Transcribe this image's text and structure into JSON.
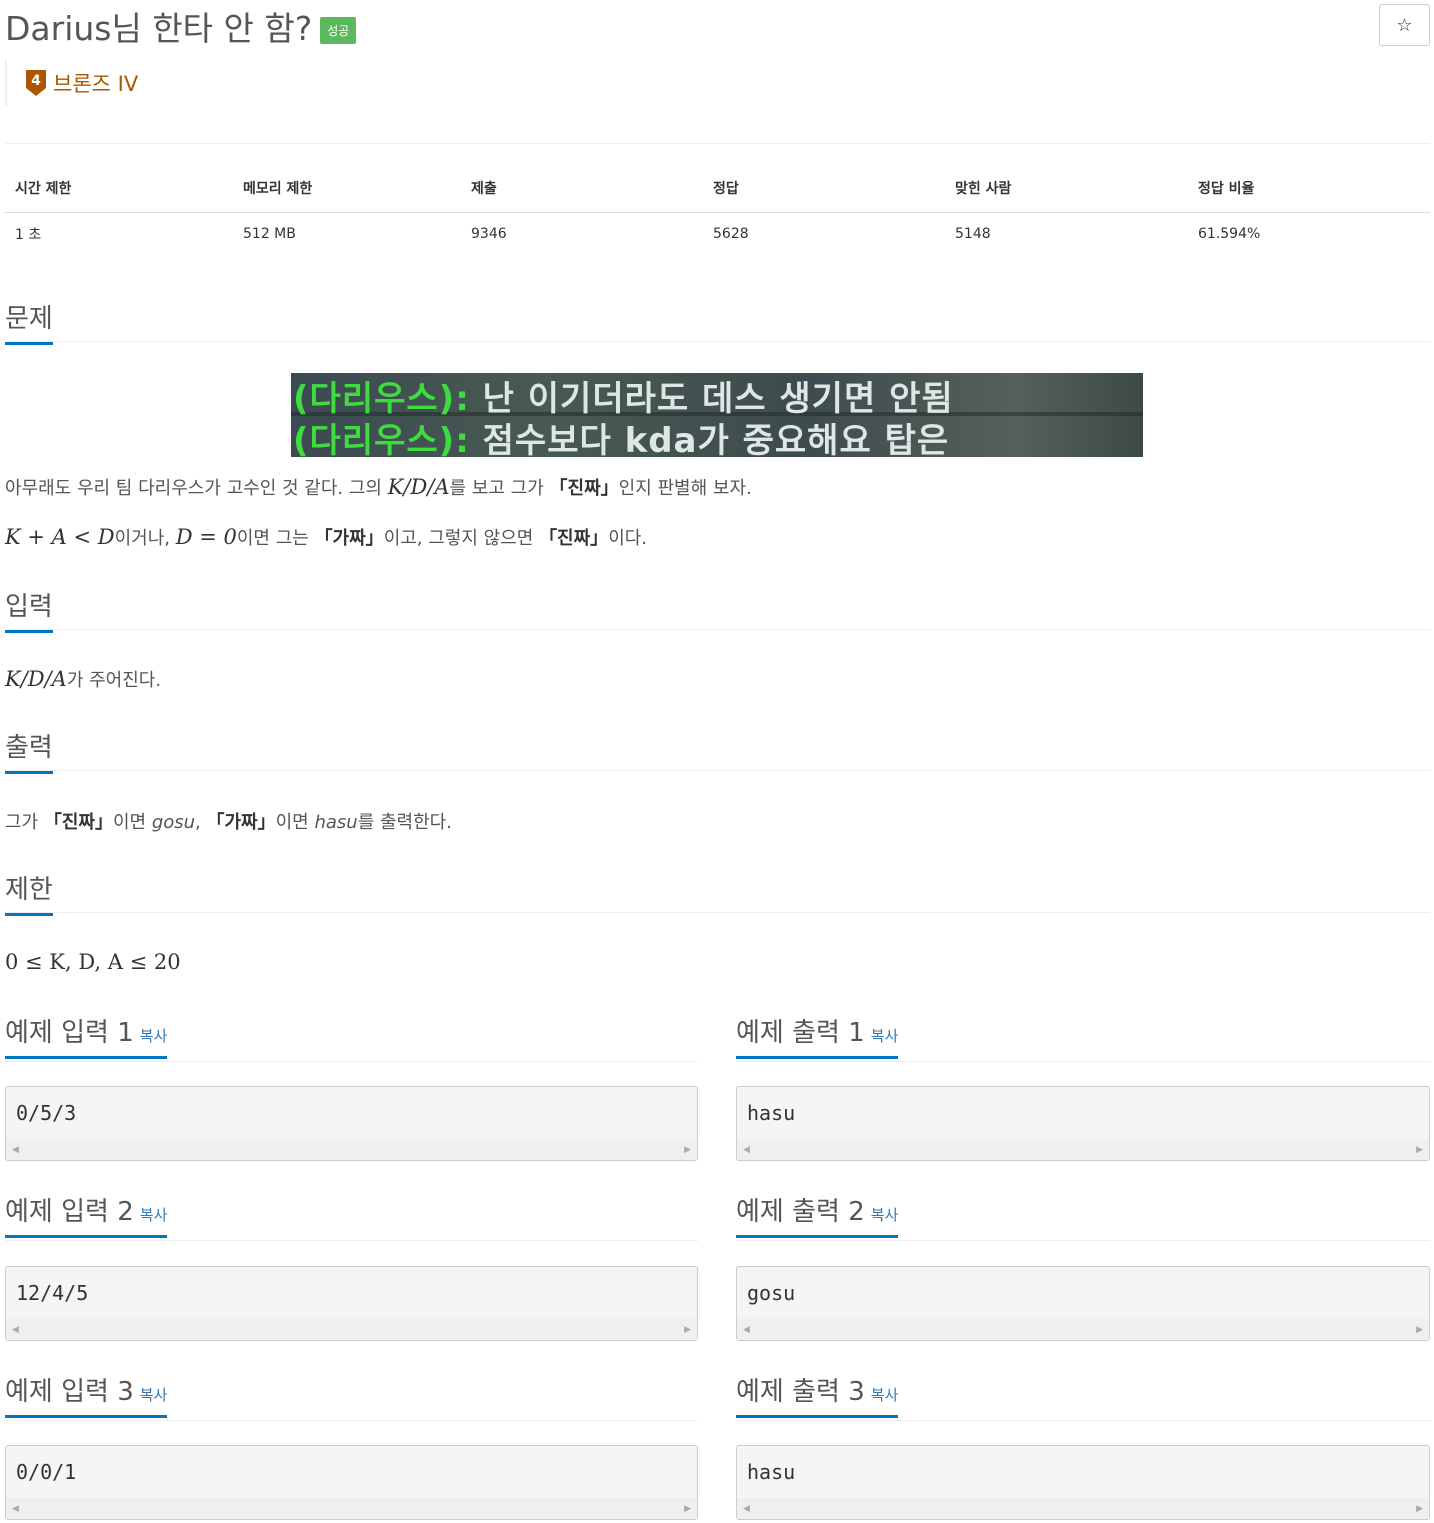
{
  "problem": {
    "title": "Darius님 한타 안 함?",
    "status_badge": "성공",
    "star_icon": "☆",
    "tier_number": "4",
    "tier_label": "브론즈 IV",
    "tier_color": "#ad5600"
  },
  "info_table": {
    "headers": [
      "시간 제한",
      "메모리 제한",
      "제출",
      "정답",
      "맞힌 사람",
      "정답 비율"
    ],
    "values": [
      "1 초",
      "512 MB",
      "9346",
      "5628",
      "5148",
      "61.594%"
    ]
  },
  "sections": {
    "problem": "문제",
    "input": "입력",
    "output": "출력",
    "limit": "제한"
  },
  "image": {
    "line1_name": "(다리우스):",
    "line1_msg": "난 이기더라도 데스 생기면 안됨",
    "line2_name": "(다리우스):",
    "line2_msg": "점수보다 kda가 중요해요 탑은"
  },
  "text": {
    "p1_a": "아무래도 우리 팀 다리우스가 고수인 것 같다. 그의 ",
    "p1_math": "K/D/A",
    "p1_b": "를 보고 그가 ",
    "p1_q": "「진짜」",
    "p1_c": "인지 판별해 보자.",
    "p2_math1": "K + A < D",
    "p2_a": "이거나, ",
    "p2_math2": "D = 0",
    "p2_b": "이면 그는 ",
    "p2_q1": "「가짜」",
    "p2_c": "이고, 그렇지 않으면 ",
    "p2_q2": "「진짜」",
    "p2_d": "이다.",
    "input_math": "K/D/A",
    "input_text": "가 주어진다.",
    "out_a": "그가 ",
    "out_q1": "「진짜」",
    "out_b": "이면 ",
    "out_gosu": "gosu",
    "out_c": ", ",
    "out_q2": "「가짜」",
    "out_d": "이면 ",
    "out_hasu": "hasu",
    "out_e": "를 출력한다.",
    "limit_math": "0 ≤ K, D, A ≤ 20"
  },
  "samples": {
    "copy_label": "복사",
    "in1_title": "예제 입력 1",
    "out1_title": "예제 출력 1",
    "in1": "0/5/3",
    "out1": "hasu",
    "in2_title": "예제 입력 2",
    "out2_title": "예제 출력 2",
    "in2": "12/4/5",
    "out2": "gosu",
    "in3_title": "예제 입력 3",
    "out3_title": "예제 출력 3",
    "in3": "0/0/1",
    "out3": "hasu"
  }
}
